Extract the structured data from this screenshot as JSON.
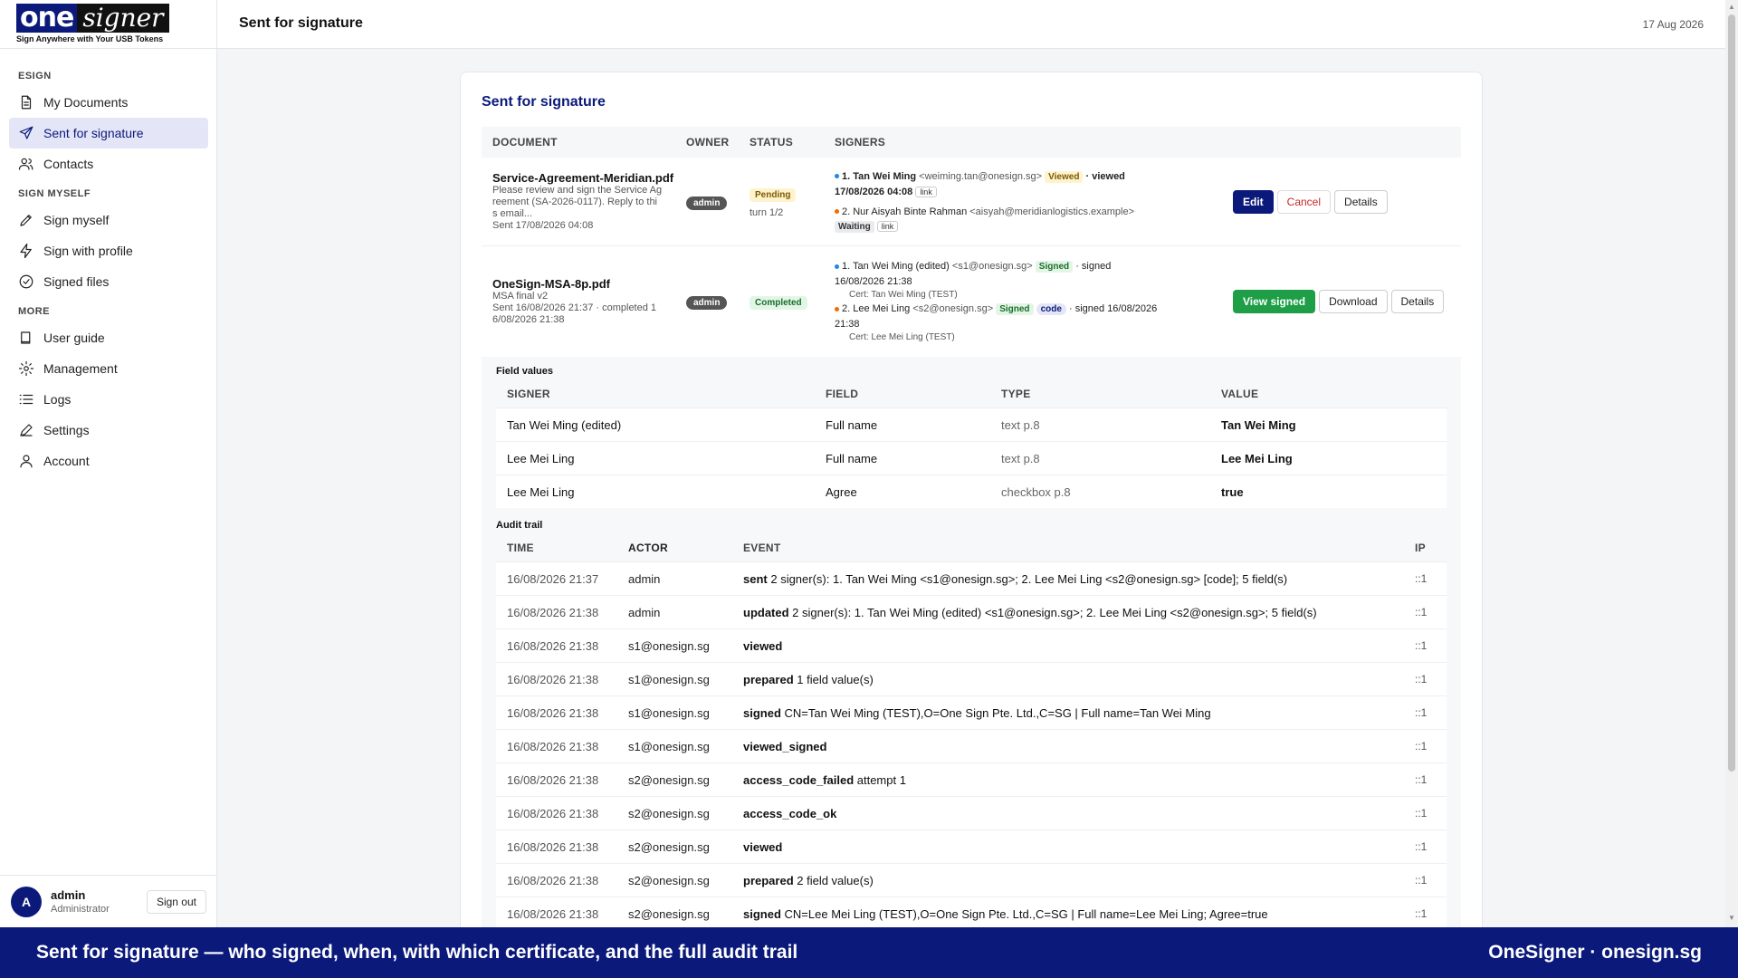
{
  "brand": {
    "logo_one": "one",
    "logo_signer": "signer",
    "tagline": "Sign Anywhere with Your USB Tokens"
  },
  "header": {
    "title": "Sent for signature",
    "date": "17 Aug 2026"
  },
  "sidebar": {
    "sections": [
      {
        "label": "ESIGN",
        "items": [
          {
            "label": "My Documents",
            "icon": "document-icon"
          },
          {
            "label": "Sent for signature",
            "icon": "send-icon",
            "active": true
          },
          {
            "label": "Contacts",
            "icon": "users-icon"
          }
        ]
      },
      {
        "label": "SIGN MYSELF",
        "items": [
          {
            "label": "Sign myself",
            "icon": "pen-icon"
          },
          {
            "label": "Sign with profile",
            "icon": "bolt-icon"
          },
          {
            "label": "Signed files",
            "icon": "check-circle-icon"
          }
        ]
      },
      {
        "label": "MORE",
        "items": [
          {
            "label": "User guide",
            "icon": "book-icon"
          },
          {
            "label": "Management",
            "icon": "gear-icon"
          },
          {
            "label": "Logs",
            "icon": "list-icon"
          },
          {
            "label": "Settings",
            "icon": "pencil-icon"
          },
          {
            "label": "Account",
            "icon": "user-icon"
          }
        ]
      }
    ],
    "user": {
      "initial": "A",
      "name": "admin",
      "role": "Administrator",
      "signout": "Sign out"
    }
  },
  "card": {
    "title": "Sent for signature",
    "columns": [
      "DOCUMENT",
      "OWNER",
      "STATUS",
      "SIGNERS"
    ],
    "documents": [
      {
        "name": "Service-Agreement-Meridian.pdf",
        "desc1": "Please review and sign the Service Ag",
        "desc2": "reement (SA-2026-0117). Reply to thi",
        "desc3": "s email...",
        "sent": "Sent 17/08/2026 04:08",
        "owner": "admin",
        "status": "Pending",
        "turn": "turn 1/2",
        "signer1": {
          "name": "1. Tan Wei Ming",
          "email": "<weiming.tan@onesign.sg>",
          "badge": "Viewed",
          "tail": "· viewed",
          "date": "17/08/2026 04:08",
          "link": "link"
        },
        "signer2": {
          "name": "2. Nur Aisyah Binte Rahman",
          "email": "<aisyah@meridianlogistics.example>",
          "badge": "Waiting",
          "link": "link"
        },
        "actions": {
          "edit": "Edit",
          "cancel": "Cancel",
          "details": "Details"
        }
      },
      {
        "name": "OneSign-MSA-8p.pdf",
        "desc1": "MSA final v2",
        "desc2": "Sent 16/08/2026 21:37 · completed 1",
        "desc3": "6/08/2026 21:38",
        "owner": "admin",
        "status": "Completed",
        "signer1": {
          "name": "1. Tan Wei Ming (edited)",
          "email": "<s1@onesign.sg>",
          "badge": "Signed",
          "tail": "· signed",
          "date": "16/08/2026 21:38",
          "cert": "Cert: Tan Wei Ming (TEST)"
        },
        "signer2": {
          "name": "2. Lee Mei Ling",
          "email": "<s2@onesign.sg>",
          "badge": "Signed",
          "code": "code",
          "tail": "· signed 16/08/2026",
          "date": "21:38",
          "cert": "Cert: Lee Mei Ling (TEST)"
        },
        "actions": {
          "view": "View signed",
          "download": "Download",
          "details": "Details"
        }
      }
    ]
  },
  "field_values": {
    "title": "Field values",
    "columns": [
      "SIGNER",
      "FIELD",
      "TYPE",
      "VALUE"
    ],
    "rows": [
      [
        "Tan Wei Ming (edited)",
        "Full name",
        "text p.8",
        "Tan Wei Ming"
      ],
      [
        "Lee Mei Ling",
        "Full name",
        "text p.8",
        "Lee Mei Ling"
      ],
      [
        "Lee Mei Ling",
        "Agree",
        "checkbox p.8",
        "true"
      ]
    ]
  },
  "audit": {
    "title": "Audit trail",
    "columns": [
      "TIME",
      "ACTOR",
      "EVENT",
      "IP"
    ],
    "rows": [
      {
        "time": "16/08/2026 21:37",
        "actor": "admin",
        "event": "sent",
        "detail": " 2 signer(s): 1. Tan Wei Ming <s1@onesign.sg>; 2. Lee Mei Ling <s2@onesign.sg> [code]; 5 field(s)",
        "ip": "::1"
      },
      {
        "time": "16/08/2026 21:38",
        "actor": "admin",
        "event": "updated",
        "detail": " 2 signer(s): 1. Tan Wei Ming (edited) <s1@onesign.sg>; 2. Lee Mei Ling <s2@onesign.sg>; 5 field(s)",
        "ip": "::1"
      },
      {
        "time": "16/08/2026 21:38",
        "actor": "s1@onesign.sg",
        "event": "viewed",
        "detail": "",
        "ip": "::1"
      },
      {
        "time": "16/08/2026 21:38",
        "actor": "s1@onesign.sg",
        "event": "prepared",
        "detail": " 1 field value(s)",
        "ip": "::1"
      },
      {
        "time": "16/08/2026 21:38",
        "actor": "s1@onesign.sg",
        "event": "signed",
        "detail": " CN=Tan Wei Ming (TEST),O=One Sign Pte. Ltd.,C=SG | Full name=Tan Wei Ming",
        "ip": "::1"
      },
      {
        "time": "16/08/2026 21:38",
        "actor": "s1@onesign.sg",
        "event": "viewed_signed",
        "detail": "",
        "ip": "::1"
      },
      {
        "time": "16/08/2026 21:38",
        "actor": "s2@onesign.sg",
        "event": "access_code_failed",
        "detail": " attempt 1",
        "ip": "::1"
      },
      {
        "time": "16/08/2026 21:38",
        "actor": "s2@onesign.sg",
        "event": "access_code_ok",
        "detail": "",
        "ip": "::1"
      },
      {
        "time": "16/08/2026 21:38",
        "actor": "s2@onesign.sg",
        "event": "viewed",
        "detail": "",
        "ip": "::1"
      },
      {
        "time": "16/08/2026 21:38",
        "actor": "s2@onesign.sg",
        "event": "prepared",
        "detail": " 2 field value(s)",
        "ip": "::1"
      },
      {
        "time": "16/08/2026 21:38",
        "actor": "s2@onesign.sg",
        "event": "signed",
        "detail": " CN=Lee Mei Ling (TEST),O=One Sign Pte. Ltd.,C=SG | Full name=Lee Mei Ling; Agree=true",
        "ip": "::1"
      }
    ]
  },
  "banner": {
    "left": "Sent for signature — who signed, when, with which certificate, and the full audit trail",
    "right": "OneSigner · onesign.sg"
  },
  "colors": {
    "brand": "#0b1a7a",
    "success": "#1e9e46",
    "danger": "#c62828"
  }
}
